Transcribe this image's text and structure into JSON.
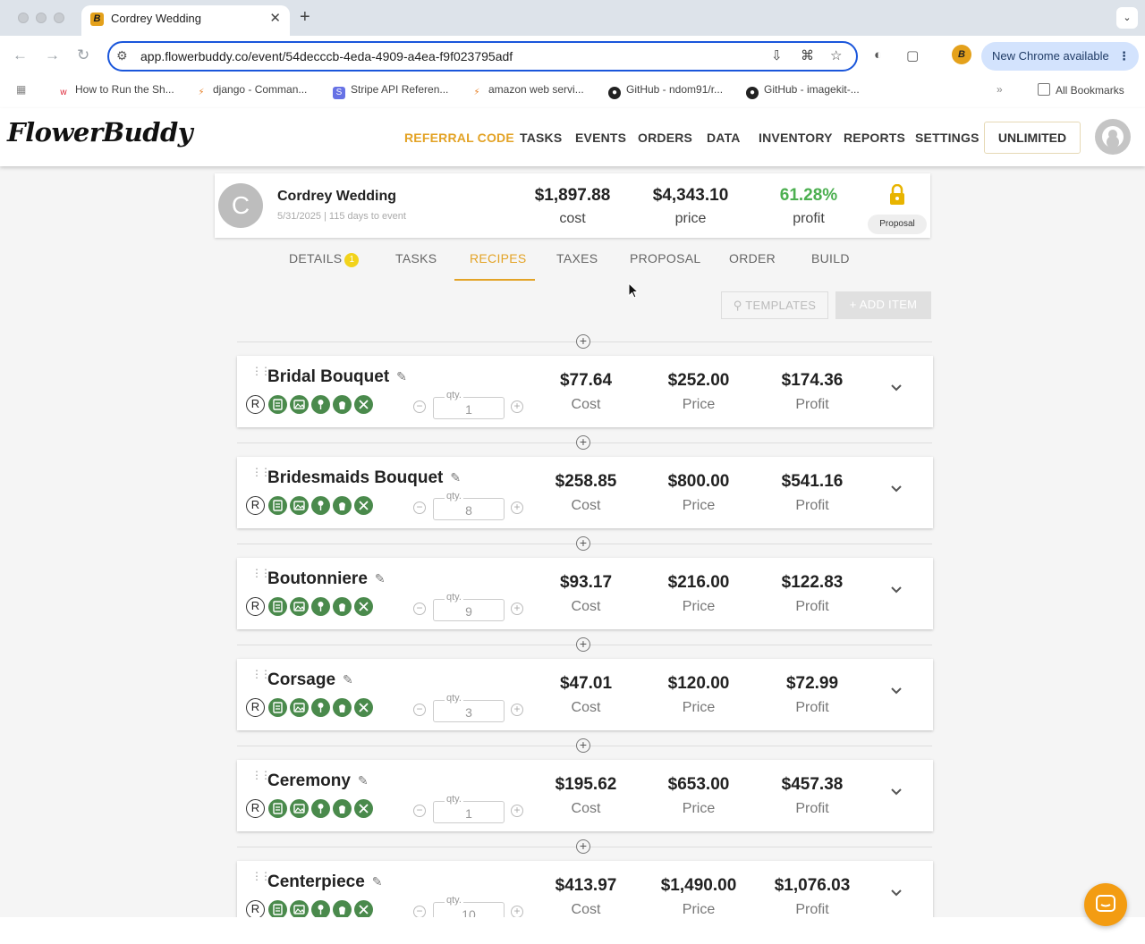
{
  "browser": {
    "tab_title": "Cordrey Wedding",
    "url": "app.flowerbuddy.co/event/54decccb-4eda-4909-a4ea-f9f023795adf",
    "new_chrome": "New Chrome available",
    "bookmarks": [
      "How to Run the Sh...",
      "django - Comman...",
      "Stripe API Referen...",
      "amazon web servi...",
      "GitHub - ndom91/r...",
      "GitHub - imagekit-..."
    ],
    "all_bookmarks": "All Bookmarks"
  },
  "app": {
    "logo": "FlowerBuddy",
    "nav": [
      "REFERRAL CODE",
      "TASKS",
      "EVENTS",
      "ORDERS",
      "DATA",
      "INVENTORY",
      "REPORTS",
      "SETTINGS"
    ],
    "plan": "UNLIMITED",
    "accent_color": "#e3a326",
    "icon_color": "#4a8a4c"
  },
  "event": {
    "initial": "C",
    "name": "Cordrey Wedding",
    "subtitle": "5/31/2025 | 115 days to event",
    "cost": "$1,897.88",
    "cost_label": "cost",
    "price": "$4,343.10",
    "price_label": "price",
    "profit": "61.28%",
    "profit_label": "profit",
    "status": "Proposal"
  },
  "tabs": {
    "details": "DETAILS",
    "details_badge": "1",
    "tasks": "TASKS",
    "recipes": "RECIPES",
    "taxes": "TAXES",
    "proposal": "PROPOSAL",
    "order": "ORDER",
    "build": "BUILD"
  },
  "actions": {
    "templates": "TEMPLATES",
    "add_item": "ADD ITEM"
  },
  "labels": {
    "qty": "qty.",
    "cost": "Cost",
    "price": "Price",
    "profit": "Profit",
    "recipe_badge": "R"
  },
  "recipes": [
    {
      "name": "Bridal Bouquet",
      "qty": "1",
      "cost": "$77.64",
      "price": "$252.00",
      "profit": "$174.36"
    },
    {
      "name": "Bridesmaids Bouquet",
      "qty": "8",
      "cost": "$258.85",
      "price": "$800.00",
      "profit": "$541.16"
    },
    {
      "name": "Boutonniere",
      "qty": "9",
      "cost": "$93.17",
      "price": "$216.00",
      "profit": "$122.83"
    },
    {
      "name": "Corsage",
      "qty": "3",
      "cost": "$47.01",
      "price": "$120.00",
      "profit": "$72.99"
    },
    {
      "name": "Ceremony",
      "qty": "1",
      "cost": "$195.62",
      "price": "$653.00",
      "profit": "$457.38"
    },
    {
      "name": "Centerpiece",
      "qty": "10",
      "cost": "$413.97",
      "price": "$1,490.00",
      "profit": "$1,076.03"
    }
  ]
}
